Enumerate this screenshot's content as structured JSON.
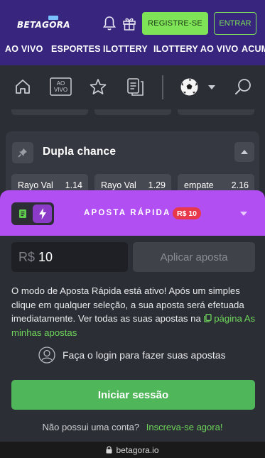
{
  "header": {
    "logo_text": "BETAGORA",
    "register_label": "REGISTRE-SE",
    "login_label": "ENTRAR",
    "icons": [
      "bell-icon",
      "gift-icon"
    ]
  },
  "nav": {
    "items": [
      "AO VIVO",
      "ESPORTES",
      "ILOTTERY",
      "ILOTTERY AO VIVO",
      "ACUM"
    ]
  },
  "toolbar": {
    "icons": [
      "home-icon",
      "ao-vivo-icon",
      "star-icon",
      "betslip-icon",
      "soccer-ball-icon",
      "chevron-down-icon",
      "search-icon"
    ],
    "ao_vivo_line1": "AO",
    "ao_vivo_line2": "VIVO"
  },
  "market": {
    "title": "Dupla chance",
    "odds": [
      {
        "label": "Rayo Val",
        "value": "1.14"
      },
      {
        "label": "Rayo Val",
        "value": "1.29"
      },
      {
        "label": "empate",
        "value": "2.16"
      }
    ]
  },
  "quick_bet": {
    "title": "APOSTA RÁPIDA",
    "badge": "R$ 10",
    "currency": "R$",
    "amount": "10",
    "apply_label": "Aplicar aposta",
    "info_text": "O modo de Aposta Rápida está ativo! Após um simples clique em qualquer seleção, a sua aposta será efetuada imediatamente. Ver todas as suas apostas na",
    "info_link": "página As minhas apostas",
    "login_prompt": "Faça o login para fazer suas apostas",
    "start_session_label": "Iniciar sessão",
    "no_account_text": "Não possui uma conta?",
    "signup_link": "Inscreva-se agora!",
    "colors": {
      "panel": "#b14ff3",
      "accent": "#4fb65a",
      "badge": "#e7394a"
    }
  },
  "browser": {
    "url": "betagora.io"
  }
}
